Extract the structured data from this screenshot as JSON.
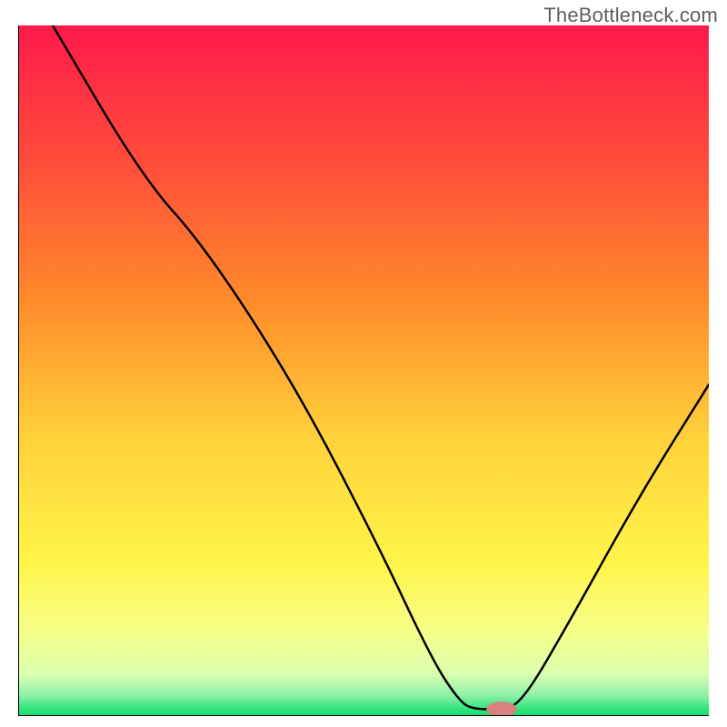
{
  "attribution": "TheBottleneck.com",
  "chart_data": {
    "type": "line",
    "title": "",
    "xlabel": "",
    "ylabel": "",
    "xlim": [
      0,
      100
    ],
    "ylim": [
      0,
      100
    ],
    "gradient_stops": [
      {
        "offset": 0,
        "color": "#ff1a4b"
      },
      {
        "offset": 20,
        "color": "#ff4d3a"
      },
      {
        "offset": 40,
        "color": "#ff8b2a"
      },
      {
        "offset": 60,
        "color": "#ffd23a"
      },
      {
        "offset": 78,
        "color": "#fff44a"
      },
      {
        "offset": 88,
        "color": "#f6ff8a"
      },
      {
        "offset": 94,
        "color": "#d9ffb0"
      },
      {
        "offset": 97,
        "color": "#8df0a8"
      },
      {
        "offset": 99,
        "color": "#2de57a"
      },
      {
        "offset": 100,
        "color": "#18d867"
      }
    ],
    "curve_points": [
      {
        "x": 5,
        "y": 100
      },
      {
        "x": 18,
        "y": 78
      },
      {
        "x": 27,
        "y": 68
      },
      {
        "x": 40,
        "y": 48
      },
      {
        "x": 52,
        "y": 25
      },
      {
        "x": 60,
        "y": 8
      },
      {
        "x": 64,
        "y": 2
      },
      {
        "x": 66,
        "y": 1
      },
      {
        "x": 70,
        "y": 1
      },
      {
        "x": 73,
        "y": 2
      },
      {
        "x": 80,
        "y": 14
      },
      {
        "x": 90,
        "y": 32
      },
      {
        "x": 100,
        "y": 48
      }
    ],
    "optimum_marker": {
      "x": 70,
      "y": 1,
      "rx": 2.2,
      "ry": 1.1
    },
    "series": [
      {
        "name": "bottleneck-curve",
        "x": [
          5,
          18,
          27,
          40,
          52,
          60,
          64,
          66,
          70,
          73,
          80,
          90,
          100
        ],
        "values": [
          100,
          78,
          68,
          48,
          25,
          8,
          2,
          1,
          1,
          2,
          14,
          32,
          48
        ]
      }
    ]
  }
}
